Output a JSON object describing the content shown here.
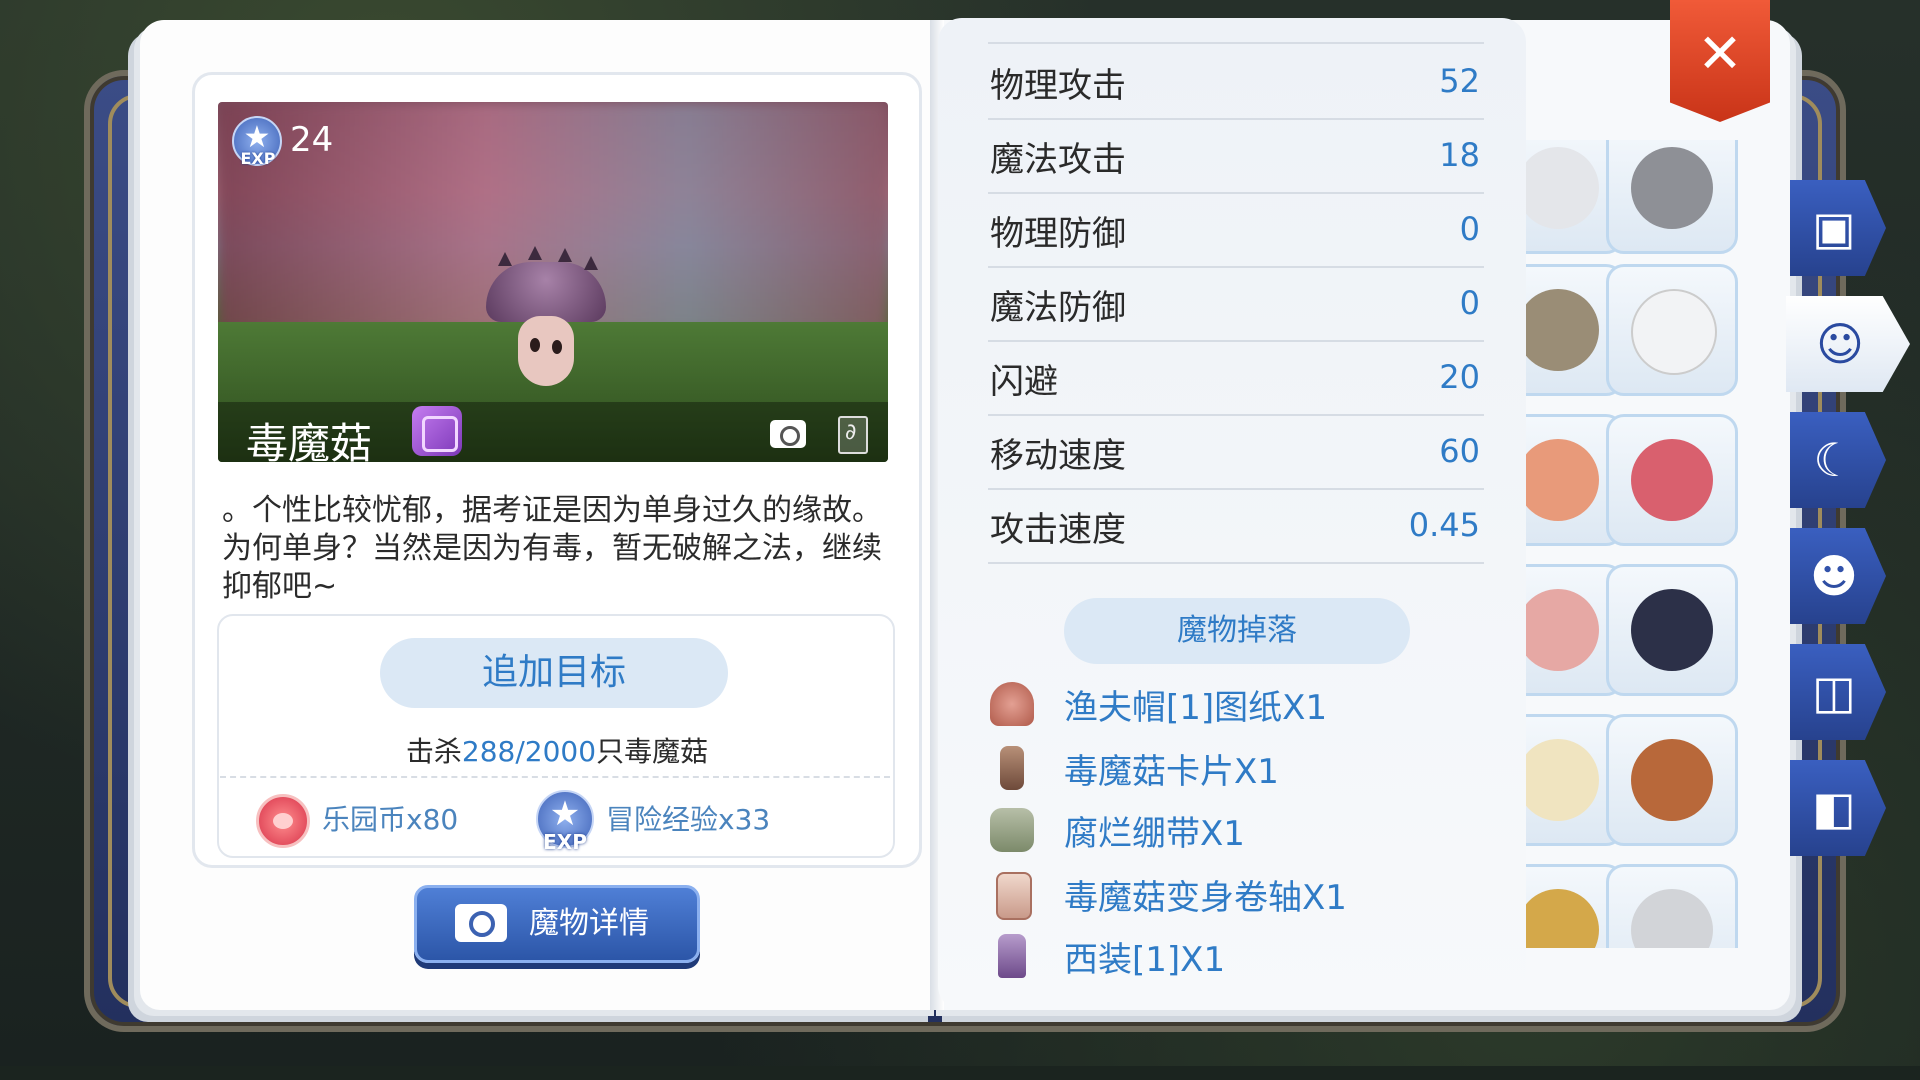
{
  "monster": {
    "name": "毒魔菇",
    "exp_level": "24",
    "exp_badge": "EXP",
    "description": "。个性比较忧郁，据考证是因为单身过久的缘故。为何单身？当然是因为有毒，暂无破解之法，继续抑郁吧~"
  },
  "goal": {
    "add_button": "追加目标",
    "kill_prefix": "击杀",
    "kill_count": "288/2000",
    "kill_suffix": "只毒魔菇",
    "rewards": [
      {
        "icon": "coin-icon",
        "label": "乐园币x80"
      },
      {
        "icon": "exp-icon",
        "badge": "EXP",
        "label": "冒险经验x33"
      }
    ]
  },
  "detail_button": "魔物详情",
  "stats": [
    {
      "label": "物理攻击",
      "value": "52"
    },
    {
      "label": "魔法攻击",
      "value": "18"
    },
    {
      "label": "物理防御",
      "value": "0"
    },
    {
      "label": "魔法防御",
      "value": "0"
    },
    {
      "label": "闪避",
      "value": "20"
    },
    {
      "label": "移动速度",
      "value": "60"
    },
    {
      "label": "攻击速度",
      "value": "0.45"
    }
  ],
  "drops": {
    "header": "魔物掉落",
    "items": [
      {
        "icon": "hat-icon",
        "label": "渔夫帽[1]图纸X1"
      },
      {
        "icon": "card-icon",
        "label": "毒魔菇卡片X1"
      },
      {
        "icon": "bandage-icon",
        "label": "腐烂绷带X1"
      },
      {
        "icon": "scroll-icon",
        "label": "毒魔菇变身卷轴X1"
      },
      {
        "icon": "suit-icon",
        "label": "西装[1]X1"
      }
    ]
  },
  "close_label": "✕",
  "side_tabs": [
    "book-icon",
    "monster-face-icon",
    "horn-icon",
    "npc-head-icon",
    "open-book-icon",
    "card-icon"
  ],
  "colors": {
    "accent": "#2f7bc6",
    "close": "#e4492a",
    "tab": "#2f4fa8"
  }
}
